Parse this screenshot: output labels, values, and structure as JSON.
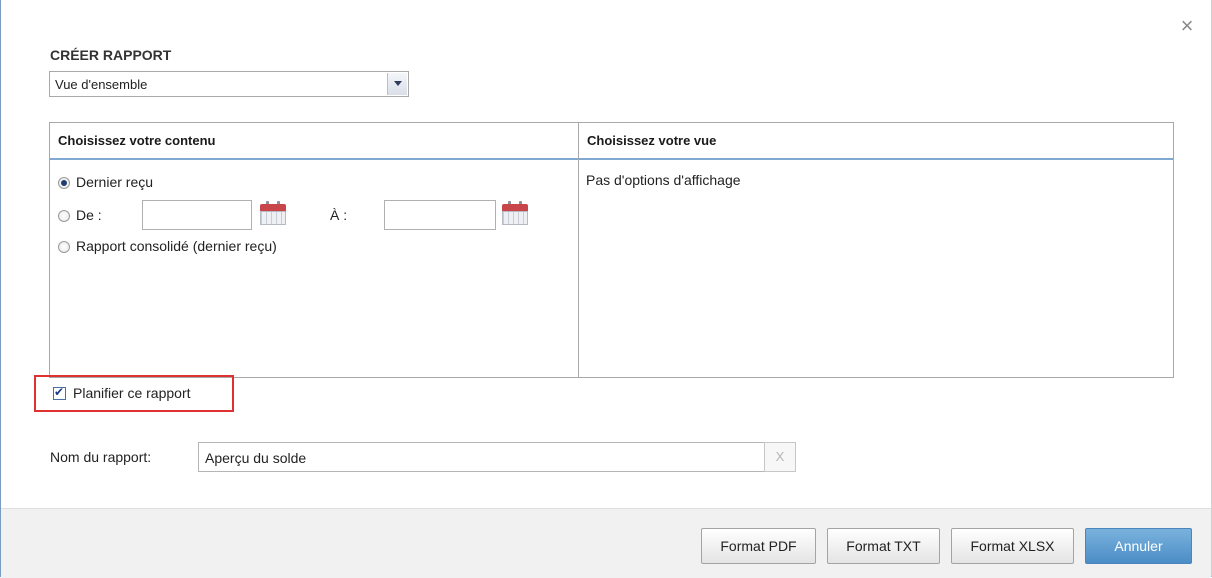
{
  "dialog": {
    "close_symbol": "×",
    "title": "CRÉER RAPPORT"
  },
  "report_type": {
    "selected": "Vue d'ensemble",
    "icon": "chevron-down-icon"
  },
  "content_panel": {
    "heading": "Choisissez votre contenu",
    "options": {
      "latest": "Dernier reçu",
      "from": "De :",
      "to": "À :",
      "consolidated": "Rapport consolidé (dernier reçu)"
    },
    "selected_option": "latest",
    "calendar_icon": "calendar-icon"
  },
  "view_panel": {
    "heading": "Choisissez votre vue",
    "message": "Pas d'options d'affichage"
  },
  "schedule": {
    "label": "Planifier ce rapport",
    "checked": true,
    "highlight_color": "#e03131"
  },
  "report_name": {
    "label": "Nom du rapport:",
    "value": "Aperçu du solde",
    "clear_label": "X"
  },
  "footer": {
    "pdf_label": "Format PDF",
    "txt_label": "Format TXT",
    "xlsx_label": "Format XLSX",
    "cancel_label": "Annuler",
    "primary_color": "#4b8dc6"
  }
}
